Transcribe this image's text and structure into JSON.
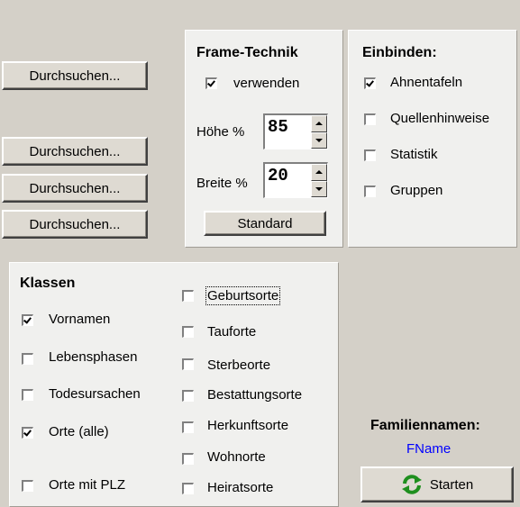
{
  "left_buttons": [
    "Durchsuchen...",
    "Durchsuchen...",
    "Durchsuchen...",
    "Durchsuchen..."
  ],
  "frame": {
    "title": "Frame-Technik",
    "use_label": "verwenden",
    "use_checked": true,
    "height_label": "Höhe %",
    "height_value": "85",
    "width_label": "Breite %",
    "width_value": "20",
    "standard_button": "Standard"
  },
  "embed": {
    "title": "Einbinden:",
    "items": [
      {
        "label": "Ahnentafeln",
        "checked": true
      },
      {
        "label": "Quellenhinweise",
        "checked": false
      },
      {
        "label": "Statistik",
        "checked": false
      },
      {
        "label": "Gruppen",
        "checked": false
      }
    ]
  },
  "classes": {
    "title": "Klassen",
    "col1": [
      {
        "label": "Vornamen",
        "checked": true
      },
      {
        "label": "Lebensphasen",
        "checked": false
      },
      {
        "label": "Todesursachen",
        "checked": false
      },
      {
        "label": "Orte (alle)",
        "checked": true
      },
      {
        "label": "Orte mit PLZ",
        "checked": false
      }
    ],
    "col2": [
      {
        "label": "Geburtsorte",
        "checked": false
      },
      {
        "label": "Tauforte",
        "checked": false
      },
      {
        "label": "Sterbeorte",
        "checked": false
      },
      {
        "label": "Bestattungsorte",
        "checked": false
      },
      {
        "label": "Herkunftsorte",
        "checked": false
      },
      {
        "label": "Wohnorte",
        "checked": false
      },
      {
        "label": "Heiratsorte",
        "checked": false
      }
    ]
  },
  "family": {
    "label": "Familiennamen:",
    "value": "FName",
    "value_color": "#0000ff",
    "start_button": "Starten",
    "start_icon": "refresh-icon"
  }
}
